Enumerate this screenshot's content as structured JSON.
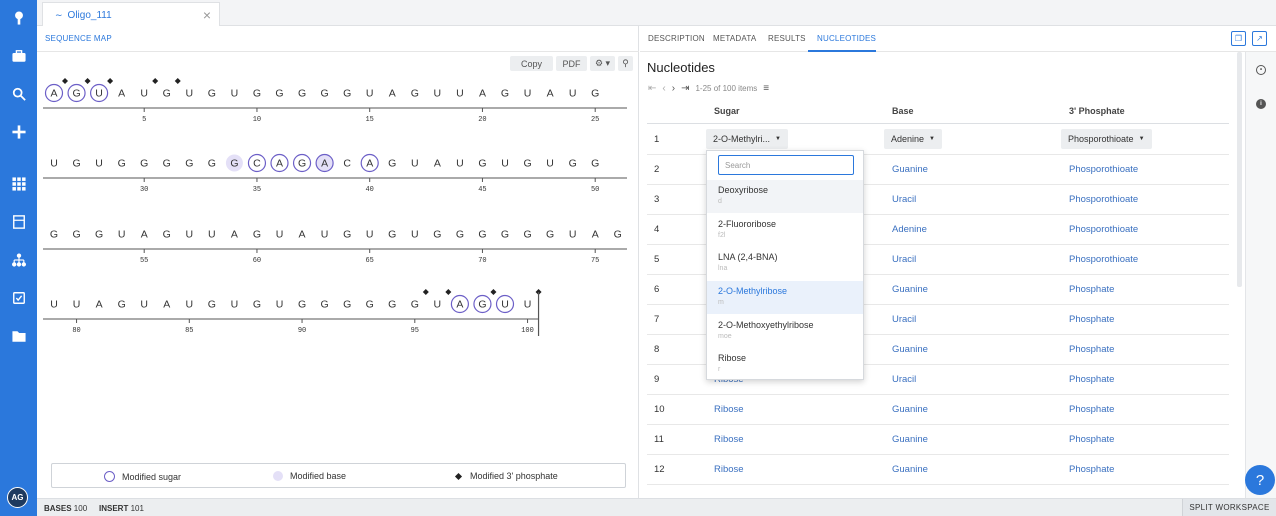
{
  "tab": {
    "title": "Oligo_111"
  },
  "left": {
    "tab": "SEQUENCE MAP",
    "toolbar": {
      "copy": "Copy",
      "pdf": "PDF"
    }
  },
  "sequence": {
    "rows": [
      {
        "bases": [
          "A",
          "G",
          "U",
          "A",
          "U",
          "G",
          "U",
          "G",
          "U",
          "G",
          "G",
          "G",
          "G",
          "G",
          "U",
          "A",
          "G",
          "U",
          "U",
          "A",
          "G",
          "U",
          "A",
          "U",
          "G"
        ],
        "start": 1
      },
      {
        "bases": [
          "U",
          "G",
          "U",
          "G",
          "G",
          "G",
          "G",
          "G",
          "G",
          "C",
          "A",
          "G",
          "A",
          "C",
          "A",
          "G",
          "U",
          "A",
          "U",
          "G",
          "U",
          "G",
          "U",
          "G",
          "G"
        ],
        "start": 26
      },
      {
        "bases": [
          "G",
          "G",
          "G",
          "U",
          "A",
          "G",
          "U",
          "U",
          "A",
          "G",
          "U",
          "A",
          "U",
          "G",
          "U",
          "G",
          "U",
          "G",
          "G",
          "G",
          "G",
          "G",
          "G",
          "U",
          "A",
          "G"
        ],
        "start": 51
      },
      {
        "bases": [
          "U",
          "U",
          "A",
          "G",
          "U",
          "A",
          "U",
          "G",
          "U",
          "G",
          "U",
          "G",
          "G",
          "G",
          "G",
          "G",
          "G",
          "U",
          "A",
          "G",
          "U",
          "U"
        ],
        "start": 79
      }
    ],
    "tick_labels": [
      [
        "5",
        "10",
        "15",
        "20",
        "25"
      ],
      [
        "30",
        "35",
        "40",
        "45",
        "50"
      ],
      [
        "55",
        "60",
        "65",
        "70",
        "75"
      ],
      [
        "80",
        "85",
        "90",
        "95",
        "100"
      ]
    ],
    "modified_sugar": [
      1,
      2,
      3,
      35,
      36,
      37,
      38,
      40,
      97,
      98,
      99
    ],
    "modified_base": [
      34,
      38
    ],
    "modified_phosphate": [
      1,
      2,
      3,
      5,
      6,
      95,
      96,
      98,
      100
    ]
  },
  "legend": {
    "sugar": "Modified sugar",
    "base": "Modified base",
    "phosphate": "Modified 3' phosphate"
  },
  "status": {
    "bases_label": "BASES",
    "bases_value": "100",
    "insert_label": "INSERT",
    "insert_value": "101",
    "split": "SPLIT WORKSPACE"
  },
  "right": {
    "tabs": [
      "DESCRIPTION",
      "METADATA",
      "RESULTS",
      "NUCLEOTIDES"
    ],
    "title": "Nucleotides",
    "pager": "1-25 of 100 items",
    "headers": {
      "sugar": "Sugar",
      "base": "Base",
      "phosphate": "3' Phosphate"
    },
    "row1": {
      "num": "1",
      "sugar": "2-O-Methylri...",
      "base": "Adenine",
      "phosphate": "Phosporothioate"
    },
    "rows": [
      {
        "num": "2",
        "sugar": "",
        "base": "Guanine",
        "phosphate": "Phosporothioate"
      },
      {
        "num": "3",
        "sugar": "",
        "base": "Uracil",
        "phosphate": "Phosporothioate"
      },
      {
        "num": "4",
        "sugar": "",
        "base": "Adenine",
        "phosphate": "Phosporothioate"
      },
      {
        "num": "5",
        "sugar": "",
        "base": "Uracil",
        "phosphate": "Phosporothioate"
      },
      {
        "num": "6",
        "sugar": "",
        "base": "Guanine",
        "phosphate": "Phosphate"
      },
      {
        "num": "7",
        "sugar": "",
        "base": "Uracil",
        "phosphate": "Phosphate"
      },
      {
        "num": "8",
        "sugar": "",
        "base": "Guanine",
        "phosphate": "Phosphate"
      },
      {
        "num": "9",
        "sugar": "Ribose",
        "base": "Uracil",
        "phosphate": "Phosphate"
      },
      {
        "num": "10",
        "sugar": "Ribose",
        "base": "Guanine",
        "phosphate": "Phosphate"
      },
      {
        "num": "11",
        "sugar": "Ribose",
        "base": "Guanine",
        "phosphate": "Phosphate"
      },
      {
        "num": "12",
        "sugar": "Ribose",
        "base": "Guanine",
        "phosphate": "Phosphate"
      }
    ],
    "dropdown": {
      "search_placeholder": "Search",
      "options": [
        {
          "label": "Deoxyribose",
          "code": "d"
        },
        {
          "label": "2-Fluororibose",
          "code": "f2l"
        },
        {
          "label": "LNA (2,4-BNA)",
          "code": "lna"
        },
        {
          "label": "2-O-Methylribose",
          "code": "m"
        },
        {
          "label": "2-O-Methoxyethylribose",
          "code": "moe"
        },
        {
          "label": "Ribose",
          "code": "r"
        }
      ]
    }
  },
  "user": {
    "initials": "AG"
  },
  "help": "?"
}
